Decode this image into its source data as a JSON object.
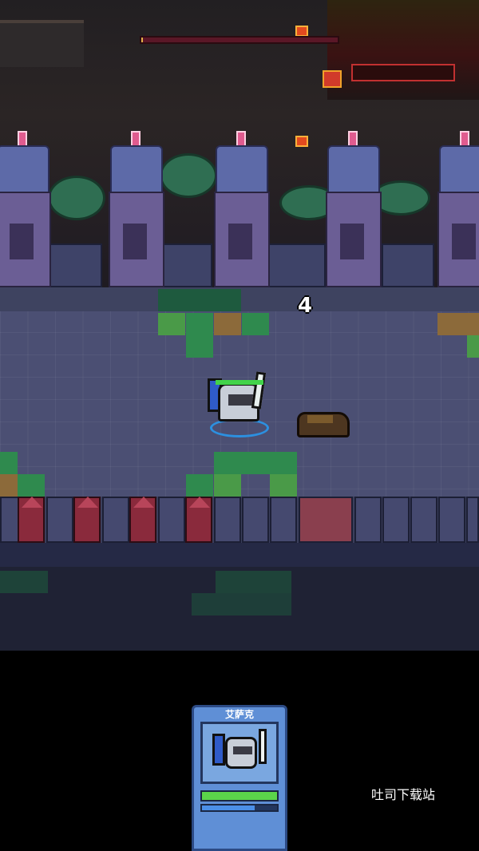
{
  "hud": {
    "boss_health": 0.01,
    "damage_number": "4"
  },
  "player": {
    "health": 1.0
  },
  "character_card": {
    "name": "艾萨克",
    "health": 1.0,
    "energy": 0.7
  },
  "watermark": "吐司下载站",
  "colors": {
    "boss_bar": "#5a1727",
    "health_green": "#42d34a",
    "energy_blue": "#4b8fe8",
    "card_blue": "#5f8fd6"
  }
}
